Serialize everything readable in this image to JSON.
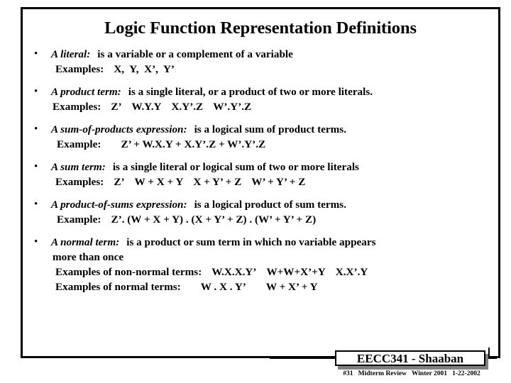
{
  "slide": {
    "title": "Logic Function Representation Definitions",
    "bullets": [
      {
        "term": "A literal:",
        "description": "is a variable or a complement of a variable",
        "lines": [
          {
            "label": "Examples:",
            "gap": "s",
            "items": [
              "X,  Y,  X’,  Y’"
            ],
            "indent": "ind-a"
          }
        ]
      },
      {
        "term": "A product term:",
        "description": "is a single literal, or a product of two or more literals.",
        "lines": [
          {
            "label": "Examples:",
            "gap": "s",
            "items": [
              "Z’",
              "W.Y.Y",
              "X.Y’.Z",
              "W’.Y’.Z"
            ],
            "indent": "ind-b"
          }
        ]
      },
      {
        "term": "A sum-of-products expression:",
        "description": "is a logical sum of product terms.",
        "lines": [
          {
            "label": "Example:",
            "gap": "m",
            "items": [
              "Z’ + W.X.Y + X.Y’.Z + W’.Y’.Z"
            ],
            "indent": "ind-c"
          }
        ]
      },
      {
        "term": "A sum term:",
        "description": "is a single literal or logical sum of two or more literals",
        "lines": [
          {
            "label": "Examples:",
            "gap": "s",
            "items": [
              "Z’",
              "W + X + Y",
              "X + Y’ + Z",
              "W’ + Y’ + Z"
            ],
            "indent": "ind-a"
          }
        ]
      },
      {
        "term": "A product-of-sums expression:",
        "description": "is a logical product of sum terms.",
        "lines": [
          {
            "label": "Example:",
            "gap": "s",
            "items": [
              "Z’. (W + X + Y) . (X + Y’ + Z) . (W’ + Y’ + Z)"
            ],
            "indent": "ind-c"
          }
        ]
      },
      {
        "term": "A normal term:",
        "description": "is a product or sum term in which no variable appears",
        "lines": [
          {
            "label": "more than once",
            "gap": "none",
            "items": [],
            "indent": "ind-b"
          },
          {
            "label": "Examples of non-normal terms:",
            "gap": "s",
            "items": [
              "W.X.X.Y’",
              "W+W+X’+Y",
              "X.X’.Y"
            ],
            "indent": "ind-a"
          },
          {
            "label": "Examples of normal terms:",
            "gap": "m",
            "items": [
              "W . X . Y’",
              "W + X’ + Y"
            ],
            "indent": "ind-a"
          }
        ]
      }
    ]
  },
  "footer": {
    "badge_label": "EECC341 - Shaaban",
    "sub_label": "#31   Midterm Review   Winter 2001   1-22-2002"
  },
  "colors": {
    "frame": "#000000",
    "text": "#000000",
    "background": "#ffffff",
    "badge_shadow": "#808080"
  },
  "bullet_marker_glyph": "•"
}
